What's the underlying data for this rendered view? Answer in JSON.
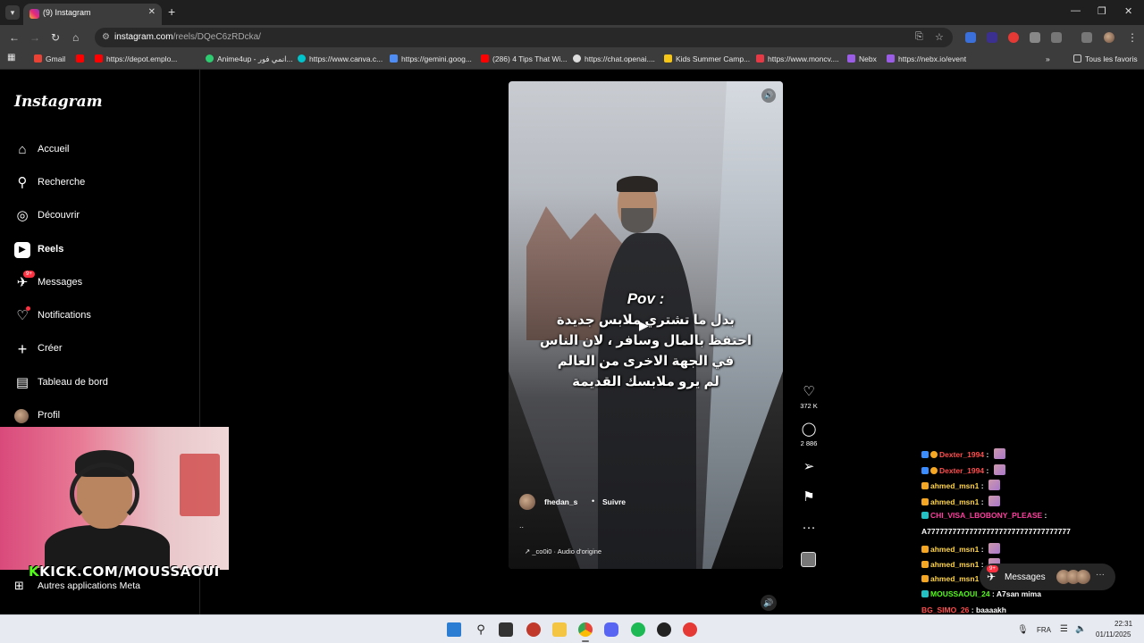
{
  "browser": {
    "tab_title": "(9) Instagram",
    "tab_close": "✕",
    "new_tab": "+",
    "url_host": "instagram.com",
    "url_path": "/reels/DQeC6zRDcka/",
    "window_controls": [
      "—",
      "❐",
      "✕"
    ],
    "bookmarks": [
      {
        "label": "Gmail",
        "color": "#ffffff"
      },
      {
        "label": "",
        "color": "#ff0000"
      },
      {
        "label": "https://depot.emplo...",
        "color": "#ff0000"
      },
      {
        "label": "Anime4up - انمي فور...",
        "color": "#2ecc71"
      },
      {
        "label": "https://www.canva.c...",
        "color": "#00c4cc"
      },
      {
        "label": "https://gemini.goog...",
        "color": "#4f8df5"
      },
      {
        "label": "(286) 4 Tips That Wi...",
        "color": "#ff0000"
      },
      {
        "label": "https://chat.openai....",
        "color": "#ffffff"
      },
      {
        "label": "Kids Summer Camp...",
        "color": "#f5c518"
      },
      {
        "label": "https://www.moncv....",
        "color": "#e63946"
      },
      {
        "label": "Nebx",
        "color": "#9b5de5"
      },
      {
        "label": "https://nebx.io/event",
        "color": "#9b5de5"
      }
    ],
    "bookmarks_more": "»",
    "all_bookmarks": "Tous les favoris"
  },
  "instagram": {
    "logo": "Instagram",
    "nav": [
      {
        "label": "Accueil",
        "icon": "home-icon",
        "glyph": "⌂"
      },
      {
        "label": "Recherche",
        "icon": "search-icon",
        "glyph": "⚲"
      },
      {
        "label": "Découvrir",
        "icon": "compass-icon",
        "glyph": "◎"
      },
      {
        "label": "Reels",
        "icon": "reels-icon",
        "glyph": "▶"
      },
      {
        "label": "Messages",
        "icon": "messages-icon",
        "glyph": "✈",
        "badge": "9+"
      },
      {
        "label": "Notifications",
        "icon": "heart-icon",
        "glyph": "♡"
      },
      {
        "label": "Créer",
        "icon": "plus-icon",
        "glyph": "+"
      },
      {
        "label": "Tableau de bord",
        "icon": "dashboard-icon",
        "glyph": "▤"
      },
      {
        "label": "Profil",
        "icon": "profile-avatar",
        "glyph": ""
      }
    ],
    "more_apps": "Autres applications Meta",
    "webcam_banner_k": "K",
    "webcam_banner": "KICK.COM/MOUSSAOUI"
  },
  "reel": {
    "pov": "Pov :",
    "caption_lines": [
      "بدل ما تشتري ملابس جديدة",
      "احتفظ بالمال وسافر ، لان الناس",
      "في الجهة الاخرى من العالم",
      "لم يرو ملابسك القديمة"
    ],
    "username": "fhedan_s",
    "separator": "•",
    "follow": "Suivre",
    "description": "..",
    "audio": "↗ _co0i0 · Audio d'origine",
    "likes": "372 K",
    "comments": "2 886"
  },
  "chat": [
    {
      "user": "Dexter_1994",
      "color": "#ff4d4d",
      "text": "",
      "emote": true
    },
    {
      "user": "Dexter_1994",
      "color": "#ff4d4d",
      "text": "",
      "emote": true
    },
    {
      "user": "ahmed_msn1",
      "color": "#ffd54a",
      "text": "",
      "emote": true
    },
    {
      "user": "ahmed_msn1",
      "color": "#ffd54a",
      "text": "",
      "emote": true
    },
    {
      "user": "CHI_VISA_LBOBONY_PLEASE",
      "color": "#ff3fa0",
      "text": "",
      "emote": false
    },
    {
      "user": "",
      "color": "#ffffff",
      "text": "A7777777777777777777777777777777777",
      "emote": false
    },
    {
      "user": "ahmed_msn1",
      "color": "#ffd54a",
      "text": "",
      "emote": true
    },
    {
      "user": "ahmed_msn1",
      "color": "#ffd54a",
      "text": "",
      "emote": true
    },
    {
      "user": "ahmed_msn1",
      "color": "#ffd54a",
      "text": "",
      "emote": false
    },
    {
      "user": "MOUSSAOUI_24",
      "color": "#53fc18",
      "text": "A7san mima",
      "emote": false
    },
    {
      "user": "BG_SIMO_26",
      "color": "#ff4d4d",
      "text": "baaaakh",
      "emote": false
    }
  ],
  "messages_pill": {
    "label": "Messages",
    "badge": "9+",
    "more": "···"
  },
  "taskbar": {
    "lang": "FRA",
    "time": "22:31",
    "date": "01/11/2025"
  }
}
